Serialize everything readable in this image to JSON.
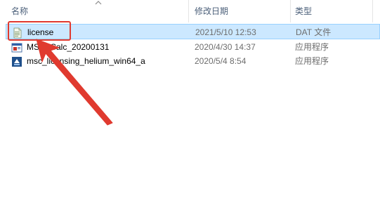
{
  "columns": {
    "name": "名称",
    "date": "修改日期",
    "type": "类型"
  },
  "files": [
    {
      "name": "license",
      "date": "2021/5/10 12:53",
      "type": "DAT 文件",
      "icon": "dat-file-icon",
      "selected": true
    },
    {
      "name": "MSC_Calc_20200131",
      "date": "2020/4/30 14:37",
      "type": "应用程序",
      "icon": "application-icon",
      "selected": false
    },
    {
      "name": "msc_licensing_helium_win64_a",
      "date": "2020/5/4 8:54",
      "type": "应用程序",
      "icon": "installer-icon",
      "selected": false
    }
  ],
  "colors": {
    "selection_fill": "#cce8ff",
    "selection_border": "#99d1ff",
    "annotation_red": "#e03a2f",
    "header_text": "#4c607a",
    "secondary_text": "#6d6d6d"
  }
}
